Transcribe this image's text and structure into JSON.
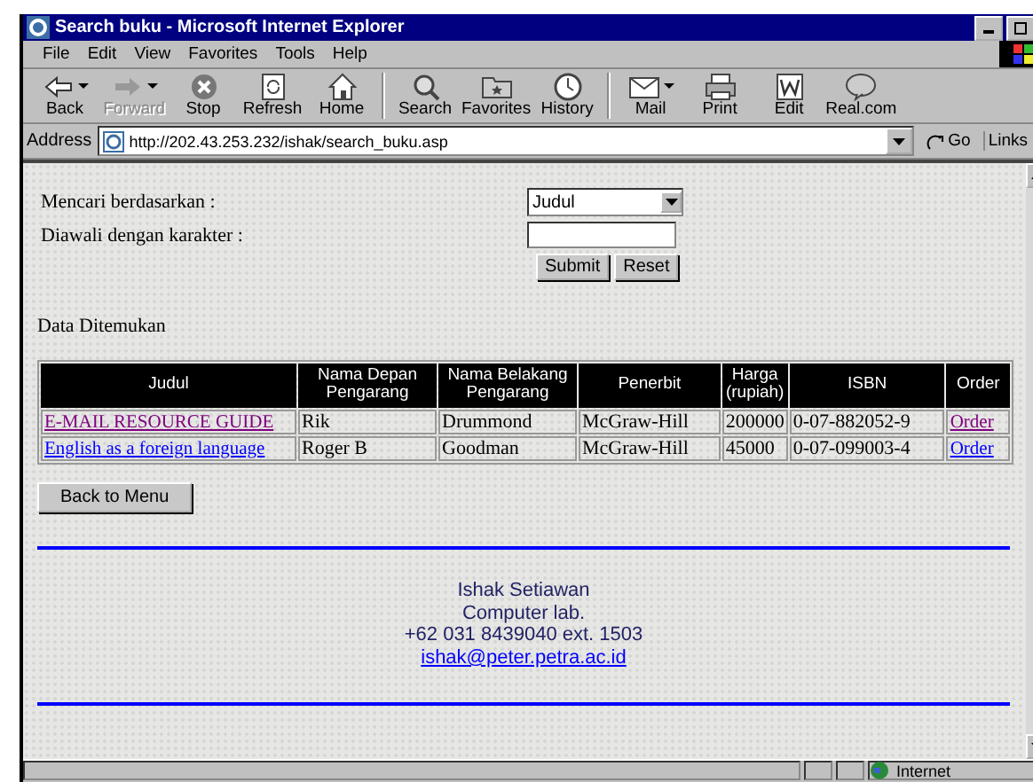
{
  "window": {
    "title": "Search buku - Microsoft Internet Explorer"
  },
  "menu": [
    "File",
    "Edit",
    "View",
    "Favorites",
    "Tools",
    "Help"
  ],
  "toolbar": [
    {
      "kind": "back",
      "label": "Back",
      "disabled": false,
      "dropdown": true
    },
    {
      "kind": "forward",
      "label": "Forward",
      "disabled": true,
      "dropdown": true
    },
    {
      "kind": "stop",
      "label": "Stop",
      "disabled": false,
      "dropdown": false
    },
    {
      "kind": "refresh",
      "label": "Refresh",
      "disabled": false,
      "dropdown": false
    },
    {
      "kind": "home",
      "label": "Home",
      "disabled": false,
      "dropdown": false
    },
    {
      "kind": "search",
      "label": "Search",
      "disabled": false,
      "dropdown": false
    },
    {
      "kind": "favorites",
      "label": "Favorites",
      "disabled": false,
      "dropdown": false
    },
    {
      "kind": "history",
      "label": "History",
      "disabled": false,
      "dropdown": false
    },
    {
      "kind": "mail",
      "label": "Mail",
      "disabled": false,
      "dropdown": true
    },
    {
      "kind": "print",
      "label": "Print",
      "disabled": false,
      "dropdown": false
    },
    {
      "kind": "edit",
      "label": "Edit",
      "disabled": false,
      "dropdown": false
    },
    {
      "kind": "real",
      "label": "Real.com",
      "disabled": false,
      "dropdown": false
    }
  ],
  "address_bar": {
    "label": "Address",
    "url": "http://202.43.253.232/ishak/search_buku.asp",
    "go": "Go",
    "links": "Links"
  },
  "form": {
    "search_by_label": "Mencari berdasarkan :",
    "search_by_value": "Judul",
    "starts_with_label": "Diawali dengan karakter :",
    "buttons": [
      "Submit",
      "Reset"
    ]
  },
  "results_heading": "Data Ditemukan",
  "table": {
    "columns": [
      "Judul",
      "Nama Depan Pengarang",
      "Nama Belakang Pengarang",
      "Penerbit",
      "Harga (rupiah)",
      "ISBN",
      "Order"
    ],
    "rows": [
      {
        "title": "E-MAIL RESOURCE GUIDE",
        "visited": true,
        "first_name": "Rik",
        "last_name": "Drummond",
        "publisher": "McGraw-Hill",
        "price": "200000",
        "isbn": "0-07-882052-9",
        "order": "Order",
        "order_visited": true
      },
      {
        "title": "English as a foreign language",
        "visited": false,
        "first_name": "Roger B",
        "last_name": "Goodman",
        "publisher": "McGraw-Hill",
        "price": "45000",
        "isbn": "0-07-099003-4",
        "order": "Order",
        "order_visited": false
      }
    ]
  },
  "back_button": "Back to Menu",
  "footer": {
    "name": "Ishak Setiawan",
    "department": "Computer lab.",
    "phone": "+62 031 8439040 ext. 1503",
    "email": "ishak@peter.petra.ac.id"
  },
  "status_bar": {
    "zone": "Internet"
  }
}
